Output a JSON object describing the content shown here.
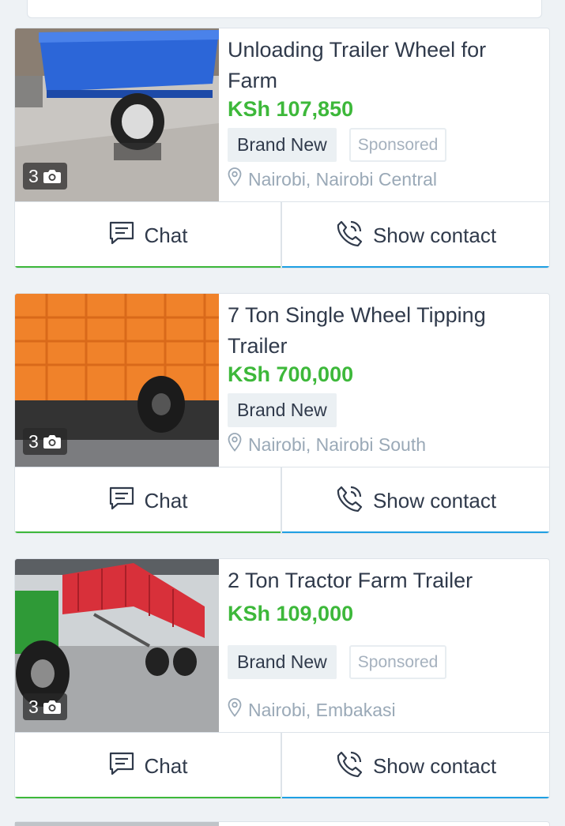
{
  "listings": [
    {
      "title": "Unloading Trailer Wheel for Farm",
      "price": "KSh 107,850",
      "condition": "Brand New",
      "sponsored": "Sponsored",
      "location": "Nairobi, Nairobi Central",
      "photo_count": "3",
      "image_color": "#2c66d8",
      "image_subject": "blue trailer"
    },
    {
      "title": "7 Ton Single Wheel Tipping Trailer",
      "price": "KSh 700,000",
      "condition": "Brand New",
      "location": "Nairobi, Nairobi South",
      "photo_count": "3",
      "image_color": "#f0822a",
      "image_subject": "orange trailer"
    },
    {
      "title": "2 Ton Tractor Farm Trailer",
      "price": "KSh 109,000",
      "condition": "Brand New",
      "sponsored": "Sponsored",
      "location": "Nairobi, Embakasi",
      "photo_count": "3",
      "image_color": "#d8303a",
      "image_subject": "red trailer with green tractor"
    }
  ],
  "actions": {
    "chat_label": "Chat",
    "contact_label": "Show contact"
  },
  "icons": {
    "camera": "camera-icon",
    "location": "location-pin-icon",
    "chat": "chat-icon",
    "phone": "phone-icon"
  },
  "colors": {
    "price": "#3db83a",
    "chat_accent": "#3db83a",
    "contact_accent": "#1fa0e3"
  }
}
